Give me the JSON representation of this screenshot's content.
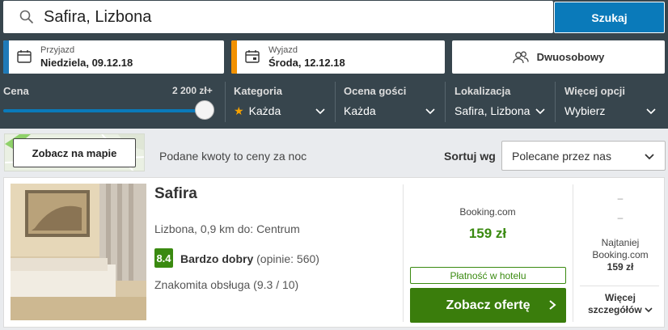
{
  "search": {
    "value": "Safira, Lizbona",
    "button_label": "Szukaj"
  },
  "checkin": {
    "label": "Przyjazd",
    "value": "Niedziela, 09.12.18",
    "accent": "#1f7ab8"
  },
  "checkout": {
    "label": "Wyjazd",
    "value": "Środa, 12.12.18",
    "accent": "#f29100"
  },
  "room": {
    "label": "Dwuosobowy"
  },
  "filters": {
    "price": {
      "label": "Cena",
      "amount": "2 200 zł+",
      "slider_level": 1.0
    },
    "category": {
      "label": "Kategoria",
      "value": "Każda"
    },
    "guest_rating": {
      "label": "Ocena gości",
      "value": "Każda"
    },
    "location": {
      "label": "Lokalizacja",
      "value": "Safira, Lizbona"
    },
    "more": {
      "label": "Więcej opcji",
      "value": "Wybierz"
    }
  },
  "map": {
    "button_label": "Zobacz na mapie"
  },
  "prices_note": "Podane kwoty to ceny za noc",
  "sort": {
    "label": "Sortuj wg",
    "value": "Polecane przez nas"
  },
  "hotel": {
    "name": "Safira",
    "location": "Lizbona, 0,9 km do: Centrum",
    "rating_score": "8.4",
    "rating_label": "Bardzo dobry",
    "rating_count": "(opinie: 560)",
    "service": "Znakomita obsługa (9.3 / 10)",
    "provider": "Booking.com",
    "price": "159 zł",
    "payment": "Płatność w hotelu",
    "deal_button": "Zobacz ofertę",
    "dash1": "–",
    "dash2": "–",
    "cheapest_line1": "Najtaniej",
    "cheapest_line2": "Booking.com",
    "cheapest_price": "159 zł",
    "more_line1": "Więcej",
    "more_line2": "szczegółów"
  },
  "colors": {
    "header_bg": "#37454d",
    "primary_blue": "#0a7aba",
    "green": "#3a8a10",
    "star": "#f7a200"
  }
}
